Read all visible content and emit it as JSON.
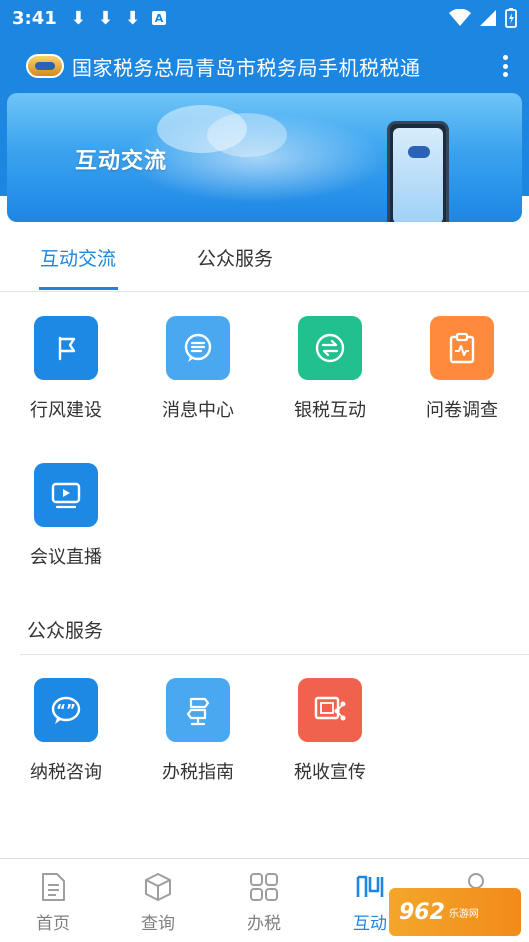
{
  "status_bar": {
    "time": "3:41",
    "download_glyph": "⬇",
    "a_badge": "A"
  },
  "app_bar": {
    "title": "国家税务总局青岛市税务局手机税税通",
    "logo_icon": "app-logo"
  },
  "banner": {
    "text": "互动交流"
  },
  "tabs": [
    {
      "label": "互动交流",
      "active": true
    },
    {
      "label": "公众服务",
      "active": false
    }
  ],
  "interaction_items": [
    {
      "label": "行风建设",
      "icon": "flag-icon",
      "color": "#1e88e5"
    },
    {
      "label": "消息中心",
      "icon": "message-icon",
      "color": "#4aa8f0"
    },
    {
      "label": "银税互动",
      "icon": "exchange-icon",
      "color": "#22c08e"
    },
    {
      "label": "问卷调查",
      "icon": "clipboard-icon",
      "color": "#ff8a3c"
    },
    {
      "label": "会议直播",
      "icon": "video-icon",
      "color": "#1e88e5"
    }
  ],
  "public_section": {
    "title": "公众服务",
    "items": [
      {
        "label": "纳税咨询",
        "icon": "chat-quote-icon",
        "color": "#1e88e5"
      },
      {
        "label": "办税指南",
        "icon": "signpost-icon",
        "color": "#4aa8f0"
      },
      {
        "label": "税收宣传",
        "icon": "share-screen-icon",
        "color": "#f0624d"
      }
    ]
  },
  "bottom_nav": [
    {
      "label": "首页",
      "icon": "document-icon",
      "active": false
    },
    {
      "label": "查询",
      "icon": "cube-icon",
      "active": false
    },
    {
      "label": "办税",
      "icon": "grid-icon",
      "active": false
    },
    {
      "label": "互动",
      "icon": "interact-icon",
      "active": true
    }
  ],
  "watermark": {
    "big": "962",
    "small": "乐游网"
  },
  "colors": {
    "primary": "#1c86e0",
    "text": "#333333",
    "inactive": "#7f7f7f"
  }
}
